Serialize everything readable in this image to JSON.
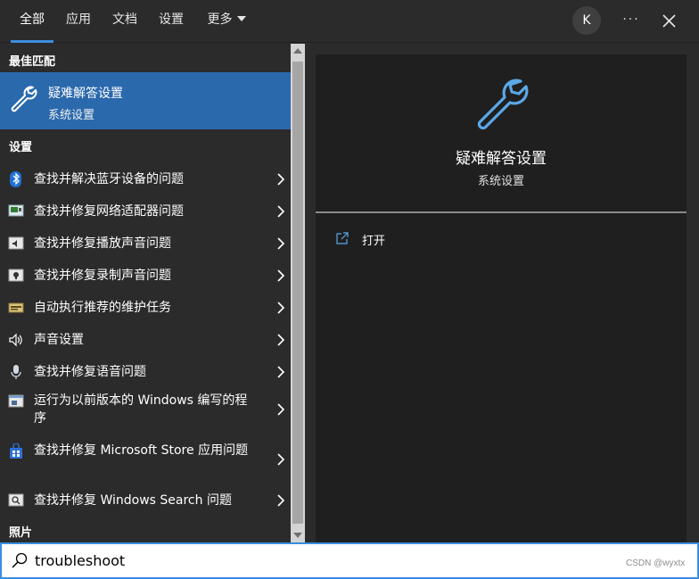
{
  "tabs": [
    {
      "label": "全部",
      "active": true
    },
    {
      "label": "应用",
      "active": false
    },
    {
      "label": "文档",
      "active": false
    },
    {
      "label": "设置",
      "active": false
    },
    {
      "label": "更多",
      "active": false
    }
  ],
  "account": {
    "initial": "K"
  },
  "more_options": "···",
  "left": {
    "best_match_header": "最佳匹配",
    "best_match": {
      "title": "疑难解答设置",
      "subtitle": "系统设置",
      "icon": "wrench-icon"
    },
    "settings_header": "设置",
    "items": [
      {
        "label": "查找并解决蓝牙设备的问题",
        "icon": "bluetooth-icon"
      },
      {
        "label": "查找并修复网络适配器问题",
        "icon": "network-adapter-icon"
      },
      {
        "label": "查找并修复播放声音问题",
        "icon": "speaker-troubleshoot-icon"
      },
      {
        "label": "查找并修复录制声音问题",
        "icon": "microphone-troubleshoot-icon"
      },
      {
        "label": "自动执行推荐的维护任务",
        "icon": "maintenance-icon"
      },
      {
        "label": "声音设置",
        "icon": "volume-icon"
      },
      {
        "label": "查找并修复语音问题",
        "icon": "microphone-icon"
      },
      {
        "label": "运行为以前版本的 Windows 编写的程序",
        "icon": "compatibility-icon"
      },
      {
        "label": "查找并修复 Microsoft Store 应用问题",
        "icon": "store-icon"
      },
      {
        "label": "查找并修复 Windows Search 问题",
        "icon": "search-troubleshoot-icon"
      }
    ],
    "photos_header": "照片"
  },
  "right": {
    "title": "疑难解答设置",
    "subtitle": "系统设置",
    "actions": [
      {
        "label": "打开",
        "icon": "open-icon"
      }
    ]
  },
  "search": {
    "value": "troubleshoot"
  },
  "watermark": "CSDN @wyxtx",
  "colors": {
    "accent": "#3b8de0",
    "selected": "#2b69ad",
    "background": "#2b2b2b",
    "preview": "#1f1f1f"
  }
}
